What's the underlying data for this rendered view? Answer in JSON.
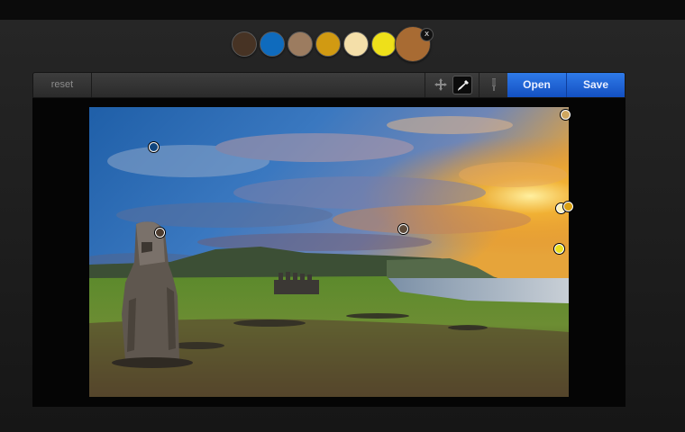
{
  "palette": {
    "swatches": [
      {
        "name": "dark-brown",
        "color": "#473324"
      },
      {
        "name": "blue",
        "color": "#0f6bbd"
      },
      {
        "name": "tan",
        "color": "#9c7c60"
      },
      {
        "name": "gold",
        "color": "#d19a12"
      },
      {
        "name": "cream",
        "color": "#f4dfa9"
      },
      {
        "name": "yellow",
        "color": "#eee01a"
      },
      {
        "name": "selected-brown",
        "color": "#a86b33"
      }
    ],
    "close_label": "x"
  },
  "toolbar": {
    "reset_label": "reset",
    "open_label": "Open",
    "save_label": "Save",
    "tools": [
      "move-icon",
      "eyedropper-icon",
      "brush-icon"
    ]
  },
  "pins": [
    {
      "color": "#10457e"
    },
    {
      "color": "#cfa760"
    },
    {
      "color": "#4d3c2f"
    },
    {
      "color": "#5e4b3a"
    },
    {
      "color": "#fff2b8"
    },
    {
      "color": "#d8a012"
    },
    {
      "color": "#ece01e"
    }
  ]
}
